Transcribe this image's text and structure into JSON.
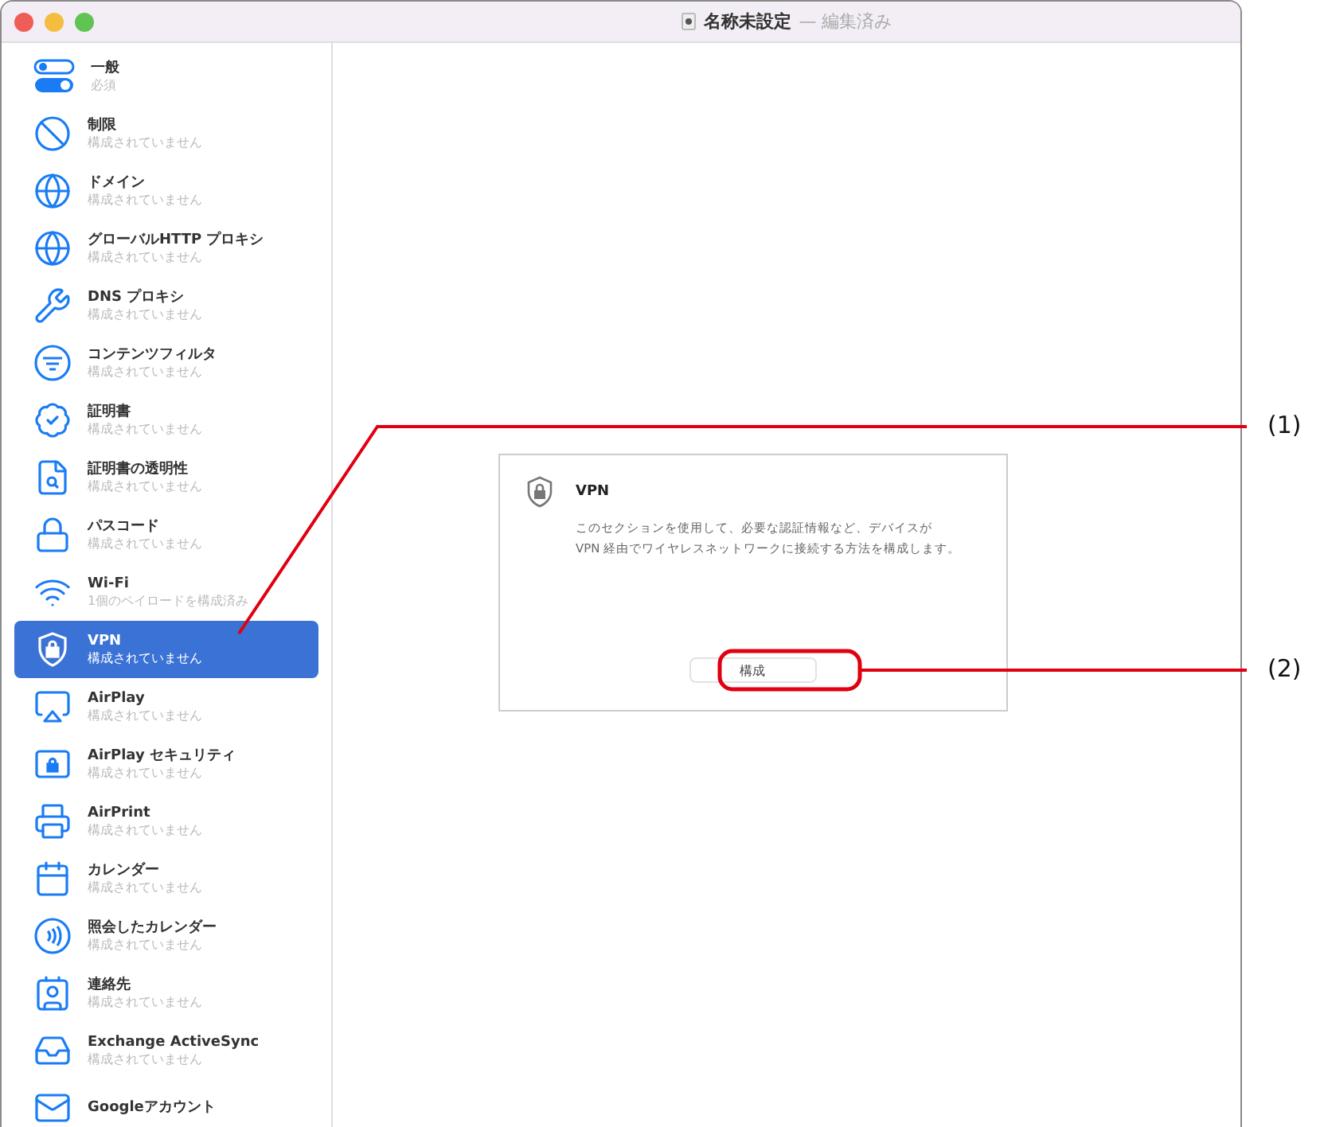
{
  "window": {
    "title": "名称未設定",
    "subtitle": "— 編集済み"
  },
  "sidebar": {
    "items": [
      {
        "title": "一般",
        "status": "必須",
        "selected": false
      },
      {
        "title": "制限",
        "status": "構成されていません",
        "selected": false
      },
      {
        "title": "ドメイン",
        "status": "構成されていません",
        "selected": false
      },
      {
        "title": "グローバルHTTP プロキシ",
        "status": "構成されていません",
        "selected": false
      },
      {
        "title": "DNS プロキシ",
        "status": "構成されていません",
        "selected": false
      },
      {
        "title": "コンテンツフィルタ",
        "status": "構成されていません",
        "selected": false
      },
      {
        "title": "証明書",
        "status": "構成されていません",
        "selected": false
      },
      {
        "title": "証明書の透明性",
        "status": "構成されていません",
        "selected": false
      },
      {
        "title": "パスコード",
        "status": "構成されていません",
        "selected": false
      },
      {
        "title": "Wi-Fi",
        "status": "1個のペイロードを構成済み",
        "selected": false
      },
      {
        "title": "VPN",
        "status": "構成されていません",
        "selected": true
      },
      {
        "title": "AirPlay",
        "status": "構成されていません",
        "selected": false
      },
      {
        "title": "AirPlay セキュリティ",
        "status": "構成されていません",
        "selected": false
      },
      {
        "title": "AirPrint",
        "status": "構成されていません",
        "selected": false
      },
      {
        "title": "カレンダー",
        "status": "構成されていません",
        "selected": false
      },
      {
        "title": "照会したカレンダー",
        "status": "構成されていません",
        "selected": false
      },
      {
        "title": "連絡先",
        "status": "構成されていません",
        "selected": false
      },
      {
        "title": "Exchange ActiveSync",
        "status": "構成されていません",
        "selected": false
      },
      {
        "title": "Googleアカウント",
        "selected": false
      }
    ]
  },
  "panel": {
    "title": "VPN",
    "description_lines": [
      "このセクションを使用して、必要な認証情報など、デバイスが",
      "VPN 経由でワイヤレスネットワークに接続する方法を構成します。"
    ],
    "button": "構成"
  },
  "callouts": [
    "(1)",
    "(2)"
  ]
}
